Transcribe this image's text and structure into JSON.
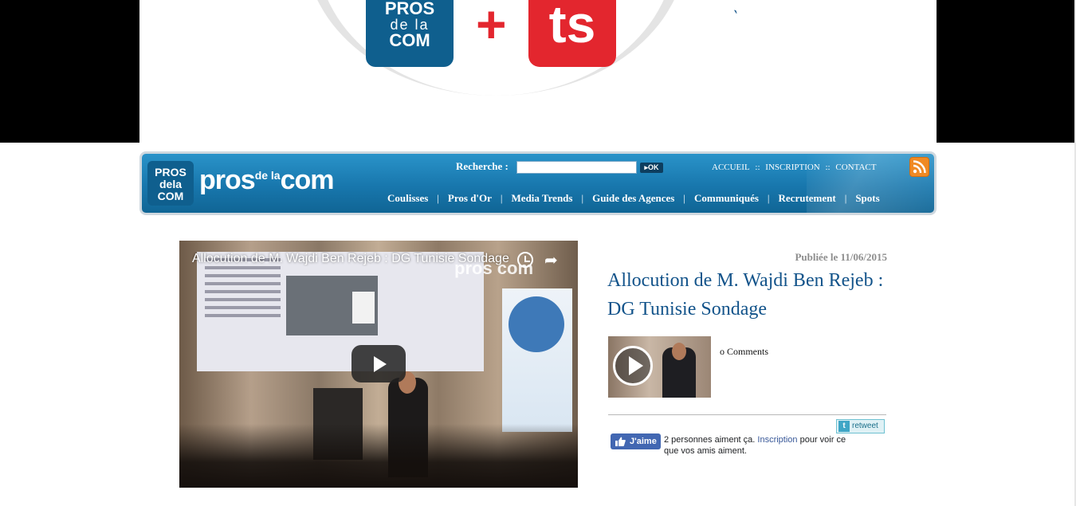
{
  "banner": {
    "pros_logo": [
      "PROS",
      "de la",
      "COM"
    ],
    "plus": "+",
    "ts_logo": "ts"
  },
  "header": {
    "logo_lines": [
      "PROS",
      "dela",
      "COM"
    ],
    "wordmark_a": "pros",
    "wordmark_sm": "de la",
    "wordmark_b": "com",
    "search_label": "Recherche :",
    "search_value": "",
    "search_button": "OK",
    "top_links": [
      "ACCUEIL",
      "INSCRIPTION",
      "CONTACT"
    ],
    "top_sep": "::",
    "nav": [
      "Coulisses",
      "Pros d'Or",
      "Media Trends",
      "Guide des Agences",
      "Communiqués",
      "Recrutement",
      "Spots"
    ],
    "nav_sep": "|"
  },
  "video": {
    "title": "Allocution de M. Wajdi Ben Rejeb : DG Tunisie Sondage",
    "watermark": "pros com"
  },
  "article": {
    "published": "Publiée le 11/06/2015",
    "title": "Allocution de M. Wajdi Ben Rejeb : DG Tunisie Sondage",
    "comments": "o Comments",
    "retweet": "retweet",
    "fb_like": "J'aime",
    "fb_text_a": "2 personnes aiment ça. ",
    "fb_link": "Inscription",
    "fb_text_b": " pour voir ce que vos amis aiment."
  },
  "colors": {
    "brand_blue": "#12538a",
    "header_blue": "#1877ad",
    "accent_red": "#e3262e",
    "rss_orange": "#f08a24",
    "facebook_blue": "#4267b2"
  }
}
